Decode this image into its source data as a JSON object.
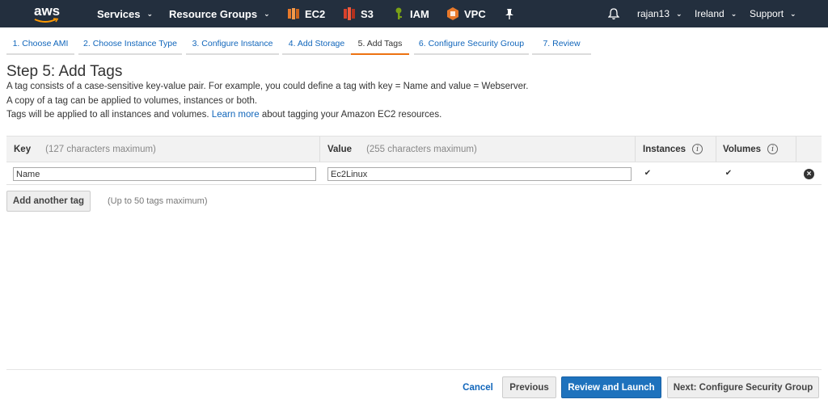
{
  "nav": {
    "logo": "aws",
    "services": "Services",
    "resource_groups": "Resource Groups",
    "ec2": "EC2",
    "s3": "S3",
    "iam": "IAM",
    "vpc": "VPC",
    "user": "rajan13",
    "region": "Ireland",
    "support": "Support",
    "colors": {
      "bar": "#232f3e",
      "ec2": "#e8792a",
      "s3": "#d9412b",
      "iam": "#7aa116",
      "vpc": "#e8792a"
    }
  },
  "wizard": {
    "tabs": [
      "1. Choose AMI",
      "2. Choose Instance Type",
      "3. Configure Instance",
      "4. Add Storage",
      "5. Add Tags",
      "6. Configure Security Group",
      "7. Review"
    ],
    "active_index": 4
  },
  "page": {
    "title": "Step 5: Add Tags",
    "line1": "A tag consists of a case-sensitive key-value pair. For example, you could define a tag with key = Name and value = Webserver.",
    "line2": "A copy of a tag can be applied to volumes, instances or both.",
    "line3_pre": "Tags will be applied to all instances and volumes.",
    "line3_link": "Learn more",
    "line3_post": "about tagging your Amazon EC2 resources."
  },
  "table": {
    "col_key": "Key",
    "col_key_hint": "(127 characters maximum)",
    "col_value": "Value",
    "col_value_hint": "(255 characters maximum)",
    "col_instances": "Instances",
    "col_volumes": "Volumes",
    "rows": [
      {
        "key": "Name",
        "value": "Ec2Linux",
        "instances": true,
        "volumes": true
      }
    ]
  },
  "add_tag": {
    "button": "Add another tag",
    "limit": "(Up to 50 tags maximum)"
  },
  "footer": {
    "cancel": "Cancel",
    "previous": "Previous",
    "review": "Review and Launch",
    "next": "Next: Configure Security Group"
  }
}
